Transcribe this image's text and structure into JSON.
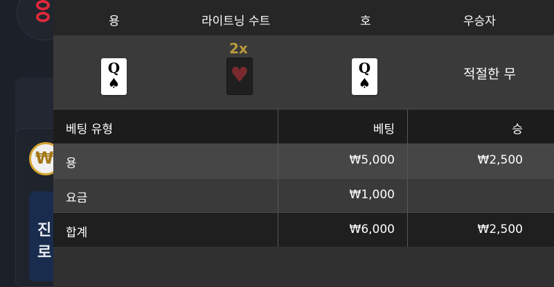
{
  "background": {
    "won_symbol": "₩",
    "text_line1": "진",
    "text_line2": "로"
  },
  "summary_header": {
    "col_dragon": "용",
    "col_lightning_suit": "라이트닝 수트",
    "col_tiger": "호",
    "col_winner": "우승자"
  },
  "summary_row": {
    "dragon_card": {
      "rank": "Q",
      "suit": "♠"
    },
    "lightning_multiplier": "2x",
    "lightning_suit": "♥",
    "tiger_card": {
      "rank": "Q",
      "suit": "♠"
    },
    "winner": "적절한 무"
  },
  "bets_table": {
    "headers": {
      "bet_type": "베팅 유형",
      "bet": "베팅",
      "win": "승"
    },
    "rows": [
      {
        "type": "용",
        "bet": "₩5,000",
        "win": "₩2,500"
      },
      {
        "type": "요금",
        "bet": "₩1,000",
        "win": ""
      },
      {
        "type": "합계",
        "bet": "₩6,000",
        "win": "₩2,500"
      }
    ]
  },
  "colors": {
    "overlay_bg": "#2e2e2e",
    "header_bg": "#262626",
    "multiplier": "#b99a3c",
    "brand_red": "#e0283a"
  }
}
